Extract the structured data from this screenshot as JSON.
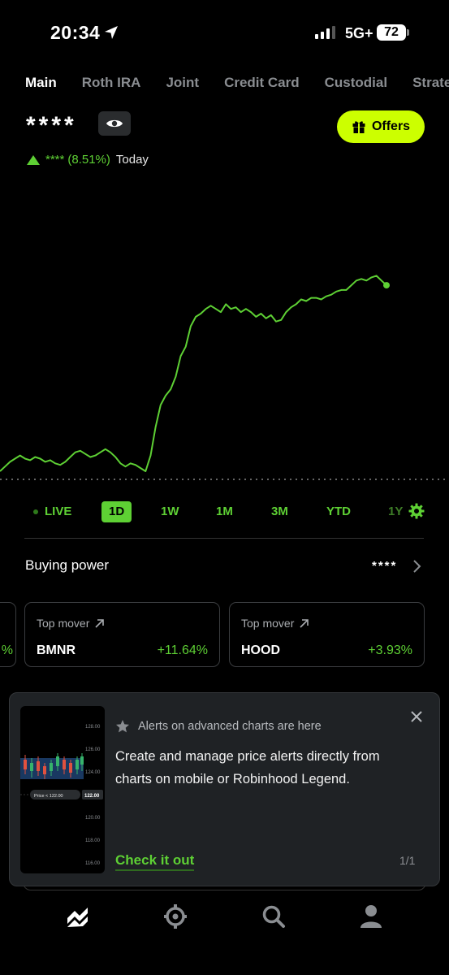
{
  "status_bar": {
    "time": "20:34",
    "network": "5G+",
    "battery": "72"
  },
  "tabs": [
    {
      "label": "Main",
      "active": true
    },
    {
      "label": "Roth IRA",
      "active": false
    },
    {
      "label": "Joint",
      "active": false
    },
    {
      "label": "Credit Card",
      "active": false
    },
    {
      "label": "Custodial",
      "active": false
    },
    {
      "label": "Strateg",
      "active": false
    }
  ],
  "balance": {
    "masked_value": "****",
    "visibility_icon": "eye-icon"
  },
  "offers_button": {
    "label": "Offers",
    "icon": "gift-icon"
  },
  "change": {
    "amount_masked": "****",
    "percent": "(8.51%)",
    "period": "Today",
    "direction": "up"
  },
  "chart_data": {
    "type": "line",
    "color": "#5ed034",
    "baseline": "dotted previous close",
    "x_range": "1D intraday",
    "values": [
      0.0,
      0.03,
      0.06,
      0.08,
      0.1,
      0.08,
      0.07,
      0.09,
      0.08,
      0.06,
      0.07,
      0.05,
      0.04,
      0.06,
      0.09,
      0.12,
      0.13,
      0.11,
      0.09,
      0.1,
      0.12,
      0.14,
      0.12,
      0.09,
      0.05,
      0.03,
      0.05,
      0.04,
      0.02,
      0.0,
      0.1,
      0.28,
      0.42,
      0.48,
      0.52,
      0.6,
      0.73,
      0.79,
      0.92,
      0.98,
      1.0,
      1.03,
      1.05,
      1.03,
      1.01,
      1.06,
      1.03,
      1.04,
      1.01,
      1.03,
      1.01,
      0.98,
      1.0,
      0.97,
      0.99,
      0.95,
      0.96,
      1.01,
      1.04,
      1.06,
      1.09,
      1.08,
      1.1,
      1.1,
      1.09,
      1.11,
      1.12,
      1.14,
      1.15,
      1.15,
      1.18,
      1.21,
      1.22,
      1.21,
      1.23,
      1.24,
      1.21,
      1.18
    ]
  },
  "time_ranges": [
    {
      "label": "LIVE",
      "active": false
    },
    {
      "label": "1D",
      "active": true
    },
    {
      "label": "1W",
      "active": false
    },
    {
      "label": "1M",
      "active": false
    },
    {
      "label": "3M",
      "active": false
    },
    {
      "label": "YTD",
      "active": false
    },
    {
      "label": "1Y",
      "active": false
    }
  ],
  "buying_power": {
    "label": "Buying power",
    "value": "****"
  },
  "movers": {
    "partial_change": "%",
    "cards": [
      {
        "heading": "Top mover",
        "symbol": "BMNR",
        "change": "+11.64%"
      },
      {
        "heading": "Top mover",
        "symbol": "HOOD",
        "change": "+3.93%"
      }
    ]
  },
  "alert_banner": {
    "heading": "Alerts on advanced charts are here",
    "body": "Create and manage price alerts directly from charts on mobile or Robinhood Legend.",
    "cta": "Check it out",
    "counter": "1/1",
    "thumbnail": {
      "price_labels": [
        "128.00",
        "126.00",
        "124.00",
        "122.00",
        "120.00",
        "118.00",
        "116.00"
      ],
      "alert_pill": "Price < 122.00",
      "alert_price": "122.00"
    }
  },
  "bottom_nav": [
    {
      "name": "investing-icon",
      "active": true
    },
    {
      "name": "crypto-icon",
      "active": false
    },
    {
      "name": "search-icon",
      "active": false
    },
    {
      "name": "account-icon",
      "active": false
    }
  ]
}
